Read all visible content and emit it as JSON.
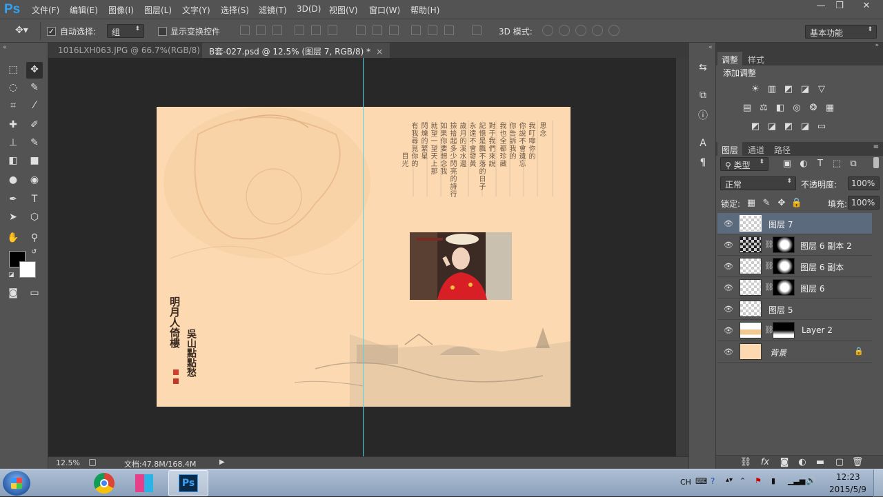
{
  "app": {
    "logo": "Ps",
    "menus": [
      "文件(F)",
      "编辑(E)",
      "图像(I)",
      "图层(L)",
      "文字(Y)",
      "选择(S)",
      "滤镜(T)",
      "3D(D)",
      "视图(V)",
      "窗口(W)",
      "帮助(H)"
    ],
    "window_controls": [
      "—",
      "❐",
      "✕"
    ]
  },
  "options": {
    "auto_select_label": "自动选择:",
    "auto_select_checked": true,
    "auto_select_value": "组",
    "show_transform_label": "显示变换控件",
    "mode3d_label": "3D 模式:",
    "workspace": "基本功能"
  },
  "tabs": [
    {
      "label": "1016LXH063.JPG @ 66.7%(RGB/8)",
      "close": "×",
      "active": false
    },
    {
      "label": "B套-027.psd @ 12.5% (图层 7, RGB/8) *",
      "close": "×",
      "active": true
    }
  ],
  "document": {
    "poem_columns": [
      "思念",
      "我叮嚀你的",
      "你說不會遺忘",
      "你告訴我的",
      "我也全都珍藏",
      "對于我們來說",
      "記憶是飄不落的日子",
      "永遠不會發黃",
      "歲月的溪水邊",
      "撿拾起多少閃亮的詩行",
      "如果你要想念我",
      "就望一望天上那",
      "閃爍的繁星",
      "有我尋覓你的",
      "目光"
    ],
    "calligraphy_1": "明月人倚樓",
    "calligraphy_2": "吳山點點愁"
  },
  "status": {
    "zoom": "12.5%",
    "doc_info": "文档:47.8M/168.4M"
  },
  "panels": {
    "adjust_tabs": [
      "调整",
      "样式"
    ],
    "add_adjustment": "添加调整",
    "layer_tabs": [
      "图层",
      "通道",
      "路径"
    ],
    "filter_type": "类型",
    "blend_mode": "正常",
    "opacity_label": "不透明度:",
    "opacity_value": "100%",
    "lock_label": "锁定:",
    "fill_label": "填充:",
    "fill_value": "100%",
    "layers": [
      {
        "name": "图层 7",
        "selected": true,
        "mask": false
      },
      {
        "name": "图层 6 副本 2",
        "selected": false,
        "mask": true
      },
      {
        "name": "图层 6 副本",
        "selected": false,
        "mask": true
      },
      {
        "name": "图层 6",
        "selected": false,
        "mask": true
      },
      {
        "name": "图层 5",
        "selected": false,
        "mask": false
      },
      {
        "name": "Layer 2",
        "selected": false,
        "mask": true
      },
      {
        "name": "背景",
        "selected": false,
        "mask": false,
        "locked": true
      }
    ]
  },
  "taskbar": {
    "ime": "CH",
    "time": "12:23",
    "date": "2015/5/9",
    "ps_label": "Ps"
  },
  "colors": {
    "ps_blue": "#2fa3f7",
    "document_bg": "#fcd9b0",
    "guide": "#4ed6e6",
    "selected_layer": "#5c6a7e"
  }
}
